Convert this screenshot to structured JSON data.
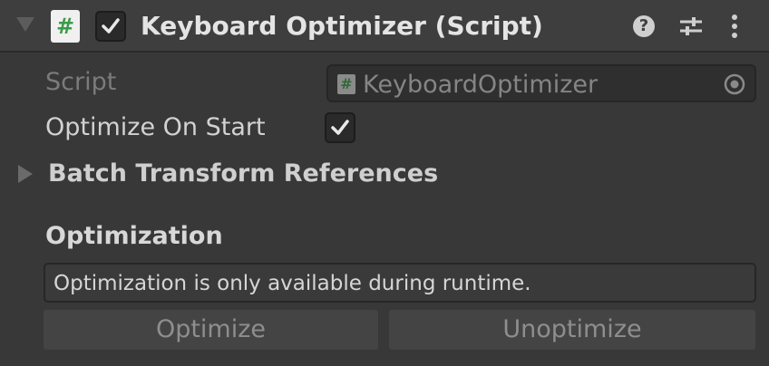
{
  "component": {
    "title": "Keyboard Optimizer (Script)",
    "enabled": true,
    "icon": "script-icon",
    "header_icons": [
      "help-icon",
      "presets-icon",
      "menu-icon"
    ]
  },
  "fields": {
    "script_label": "Script",
    "script_value": "KeyboardOptimizer",
    "optimize_on_start_label": "Optimize On Start",
    "optimize_on_start_checked": true
  },
  "batch_foldout": {
    "label": "Batch Transform References",
    "expanded": false
  },
  "optimization": {
    "title": "Optimization",
    "help_text": "Optimization is only available during runtime.",
    "optimize_label": "Optimize",
    "unoptimize_label": "Unoptimize"
  },
  "icon_glyphs": {
    "hash": "#",
    "help": "?"
  }
}
